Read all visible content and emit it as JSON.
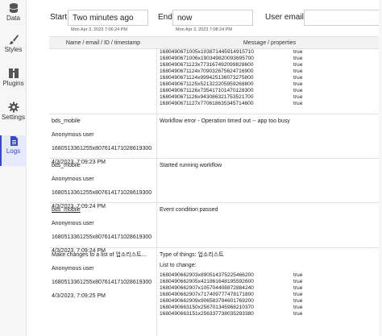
{
  "sidebar": {
    "items": [
      {
        "label": "Data",
        "icon": "database-icon"
      },
      {
        "label": "Styles",
        "icon": "brush-icon"
      },
      {
        "label": "Plugins",
        "icon": "plugins-icon"
      },
      {
        "label": "Settings",
        "icon": "gear-icon"
      },
      {
        "label": "Logs",
        "icon": "document-icon",
        "active": true
      }
    ],
    "accent": "#3a47c7"
  },
  "filters": {
    "start_label": "Start",
    "start_value": "Two minutes ago",
    "start_sub": "Mon Apr 3, 2023 7:06:24 PM",
    "end_label": "End",
    "end_value": "now",
    "end_sub": "Mon Apr 3, 2023 7:08:24 PM",
    "email_label": "User email",
    "email_value": ""
  },
  "table": {
    "headers": [
      "Name / email / ID / timestamp",
      "Message / properties"
    ],
    "top_props": [
      {
        "k": "1680490671005x103871445914915710",
        "v": "true"
      },
      {
        "k": "1680490671006x190349820093695700",
        "v": "true"
      },
      {
        "k": "1680490671123x773167492099828600",
        "v": "true"
      },
      {
        "k": "1680490671124x709032675624716900",
        "v": "true"
      },
      {
        "k": "1680490671124x999425136073275800",
        "v": "true"
      },
      {
        "k": "1680490671125x521322205959268800",
        "v": "true"
      },
      {
        "k": "1680490671126x735417101470128300",
        "v": "true"
      },
      {
        "k": "1680490671126x943086321753521700",
        "v": "true"
      },
      {
        "k": "1680490671127x770618635345714600",
        "v": "true"
      }
    ],
    "rows": [
      {
        "name": "bds_mobile",
        "user": "Anonymous user",
        "id": "1680513361255x807614171028619300",
        "time": "4/3/2023, 7:09:23 PM",
        "message": "Workflow error - Operation timed out -- app too busy"
      },
      {
        "name": "bds_mobile",
        "user": "Anonymous user",
        "id": "1680513361255x807614171028619300",
        "time": "4/3/2023, 7:09:24 PM",
        "message": "Started running workflow"
      },
      {
        "name": "bds_mobile",
        "user": "Anonymous user",
        "id": "1680513361255x807614171028619300",
        "time": "4/3/2023, 7:09:24 PM",
        "message": "Event condition passed"
      },
      {
        "name": "Make changes to a list of 업소리스트...",
        "user": "Anonymous user",
        "id": "1680513361255x807614171028619300",
        "time": "4/3/2023, 7:09:25 PM",
        "message": "Type of things: 업소리스트",
        "message2": "List to change:",
        "props": [
          {
            "k": "1680490662903x890514375225466200",
            "v": "true"
          },
          {
            "k": "1680490662905x421861648195592600",
            "v": "true"
          },
          {
            "k": "1680490662907x105704408872884240",
            "v": "true"
          },
          {
            "k": "1680490662907x717409777478171800",
            "v": "true"
          },
          {
            "k": "1680490662909x906583794601769200",
            "v": "true"
          },
          {
            "k": "1680490663150x256701345968210370",
            "v": "true"
          },
          {
            "k": "1680490663151x256337738035293380",
            "v": "true"
          }
        ]
      }
    ]
  }
}
